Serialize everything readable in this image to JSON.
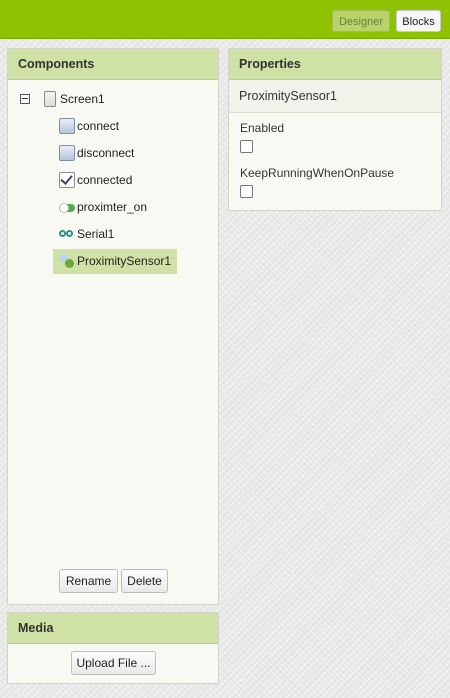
{
  "topbar": {
    "designer_label": "Designer",
    "blocks_label": "Blocks",
    "accent_color": "#8fc202"
  },
  "components": {
    "title": "Components",
    "screen_label": "Screen1",
    "items": [
      {
        "label": "connect",
        "icon": "button-icon"
      },
      {
        "label": "disconnect",
        "icon": "button-icon"
      },
      {
        "label": "connected",
        "icon": "checkbox-icon"
      },
      {
        "label": "proximter_on",
        "icon": "switch-icon"
      },
      {
        "label": "Serial1",
        "icon": "serial-icon"
      },
      {
        "label": "ProximitySensor1",
        "icon": "proximity-sensor-icon",
        "selected": true
      }
    ],
    "rename_label": "Rename",
    "delete_label": "Delete"
  },
  "properties": {
    "title": "Properties",
    "component_name": "ProximitySensor1",
    "props": [
      {
        "label": "Enabled",
        "checked": false
      },
      {
        "label": "KeepRunningWhenOnPause",
        "checked": false
      }
    ]
  },
  "media": {
    "title": "Media",
    "upload_label": "Upload File ..."
  }
}
